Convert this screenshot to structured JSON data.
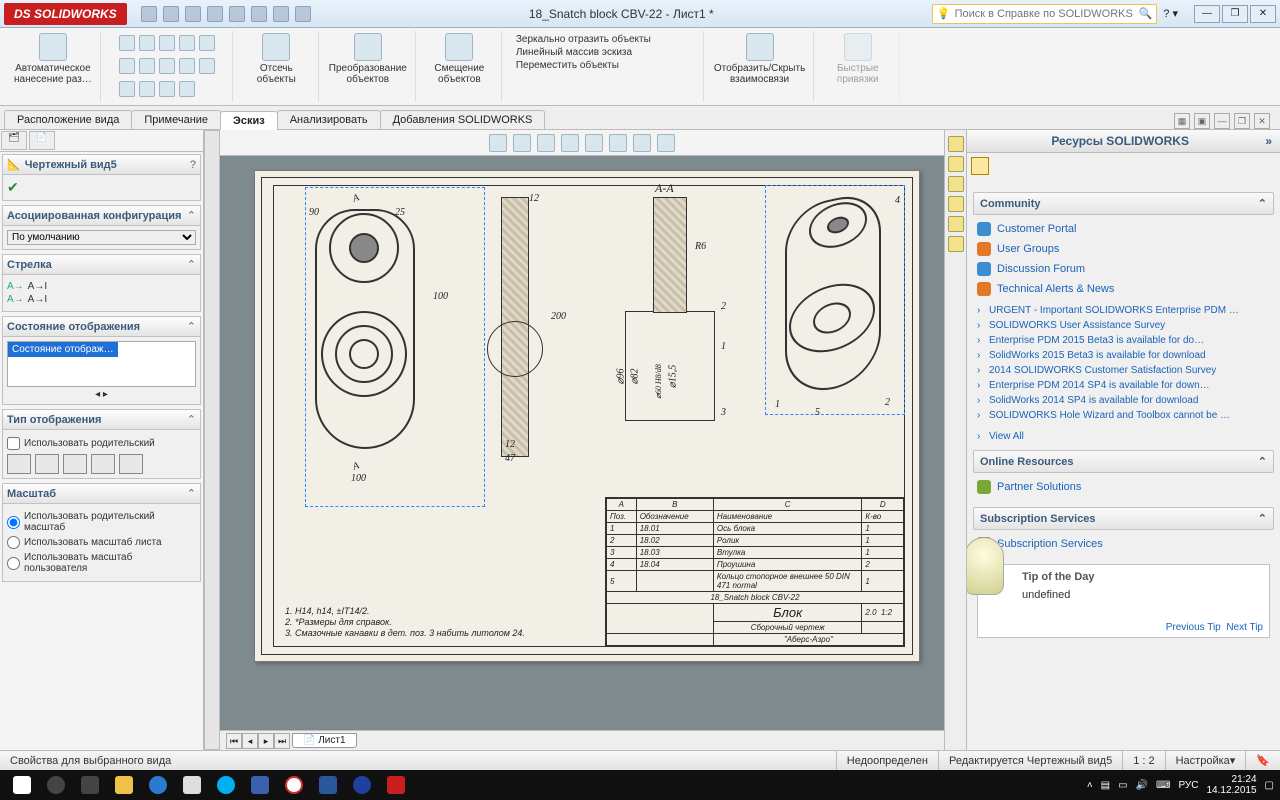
{
  "titlebar": {
    "logo": "DS SOLIDWORKS",
    "doctitle": "18_Snatch block CBV-22 - Лист1 *"
  },
  "search": {
    "placeholder": "Поиск в Справке по SOLIDWORKS"
  },
  "ribbon": {
    "auto_dim": "Автоматическое\nнанесение раз…",
    "cut": "Отсечь\nобъекты",
    "convert": "Преобразование\nобъектов",
    "offset": "Смещение\nобъектов",
    "mirror": "Зеркально отразить объекты",
    "pattern": "Линейный массив эскиза",
    "move": "Переместить объекты",
    "relations": "Отобразить/Скрыть\nвзаимосвязи",
    "snaps": "Быстрые\nпривязки"
  },
  "tabs": [
    "Расположение вида",
    "Примечание",
    "Эскиз",
    "Анализировать",
    "Добавления SOLIDWORKS"
  ],
  "active_tab": 2,
  "left": {
    "header": "Чертежный вид5",
    "cfg_section": "Асоциированная конфигурация",
    "cfg_value": "По умолчанию",
    "arrow_section": "Стрелка",
    "arrow_a1": "A→I",
    "arrow_a2": "A→I",
    "dispstate_section": "Состояние отображения",
    "dispstate_sel": "Состояние отображ…",
    "disptype_section": "Тип отображения",
    "disptype_chk": "Использовать родительский",
    "scale_section": "Масштаб",
    "scale_parent": "Использовать родительский масштаб",
    "scale_sheet": "Использовать масштаб листа",
    "scale_user": "Использовать масштаб пользователя"
  },
  "bottom_tab": "Лист1",
  "drawing": {
    "section_label_top": "A-A",
    "marker_A_top": "A",
    "marker_A_bot": "A",
    "dim_90": "90",
    "dim_25": "25",
    "dim_12a": "12",
    "dim_12b": "12",
    "dim_47": "47",
    "dim_100_h": "100",
    "dim_100_v": "100",
    "dim_200": "200",
    "dim_R6": "R6",
    "dim_d96": "⌀96",
    "dim_d82": "⌀82",
    "dim_d60": "⌀60 H8/d8",
    "dim_d155": "⌀15,5",
    "callout_1": "1",
    "callout_2": "2",
    "callout_3": "3",
    "callout_4": "4",
    "callout_5": "5",
    "bom_head": [
      "A",
      "B",
      "C",
      "D"
    ],
    "bom_sub": [
      "Поз.",
      "Обозначение",
      "Наименование",
      "К-во"
    ],
    "bom": [
      [
        "1",
        "18.01",
        "Ось блока",
        "1"
      ],
      [
        "2",
        "18.02",
        "Ролик",
        "1"
      ],
      [
        "3",
        "18.03",
        "Втулка",
        "1"
      ],
      [
        "4",
        "18.04",
        "Проушина",
        "2"
      ],
      [
        "5",
        "",
        "Кольцо стопорное внешнее 50 DIN 471 normal",
        "1"
      ]
    ],
    "title_line": "18_Snatch block CBV-22",
    "title_word": "Блок",
    "title_sub": "Сборочный чертеж",
    "lit": "2.0",
    "scale": "1:2",
    "org": "\"Аберс-Азро\"",
    "notes1": "1.   H14, h14, ±IT14/2.",
    "notes2": "2.   *Размеры для справок.",
    "notes3": "3.   Смазочные канавки в дет. поз. 3 набить литолом 24."
  },
  "task": {
    "title": "Ресурсы SOLIDWORKS",
    "community": "Community",
    "portal": "Customer Portal",
    "ugroups": "User Groups",
    "forum": "Discussion Forum",
    "alerts_head": "Technical Alerts & News",
    "alerts": [
      "URGENT - Important SOLIDWORKS Enterprise PDM …",
      "SOLIDWORKS User Assistance Survey",
      "Enterprise PDM 2015 Beta3 is available for do…",
      "SolidWorks 2015 Beta3 is available for download",
      "2014 SOLIDWORKS Customer Satisfaction Survey",
      "Enterprise PDM 2014 SP4 is available for down…",
      "SolidWorks 2014 SP4 is available for download",
      "SOLIDWORKS Hole Wizard and Toolbox cannot be …"
    ],
    "viewall": "View All",
    "online_head": "Online Resources",
    "partner": "Partner Solutions",
    "subs_head": "Subscription Services",
    "subs": "Subscription Services",
    "tip_title": "Tip of the Day",
    "tip_body": "undefined",
    "prev": "Previous Tip",
    "next": "Next Tip"
  },
  "status": {
    "left": "Свойства для выбранного вида",
    "underdef": "Недоопределен",
    "editing": "Редактируется Чертежный вид5",
    "ratio": "1 : 2",
    "custom": "Настройка"
  },
  "tray": {
    "lang": "РУС",
    "time": "21:24",
    "date": "14.12.2015"
  }
}
